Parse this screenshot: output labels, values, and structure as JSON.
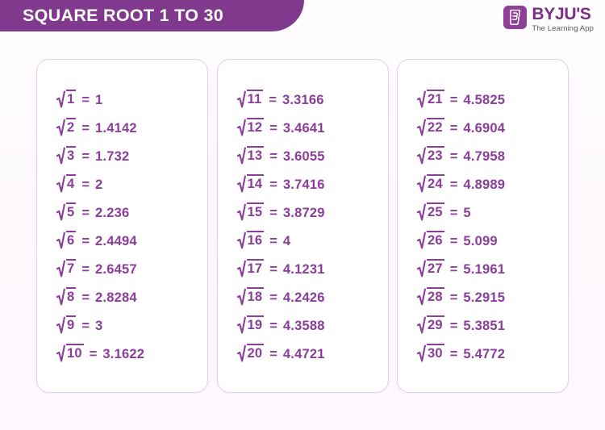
{
  "header": {
    "title": "SQUARE ROOT 1 TO 30",
    "background_color": "#80398c",
    "text_color": "#ffffff"
  },
  "logo": {
    "mark_icon": "byjus-b-logo-icon",
    "name": "BYJU'S",
    "tagline": "The Learning App",
    "mark_color": "#8f3f96",
    "name_color": "#7a2f86"
  },
  "theme": {
    "accent": "#80398c",
    "text_purple": "#8b3d9b",
    "card_border": "#e6cdea",
    "card_background": "#ffffff",
    "page_background": "#fdfbfe"
  },
  "equals_sign": "=",
  "radical_icon": "square-root-icon",
  "columns": [
    {
      "rows": [
        {
          "radicand": "1",
          "value": "1"
        },
        {
          "radicand": "2",
          "value": "1.4142"
        },
        {
          "radicand": "3",
          "value": "1.732"
        },
        {
          "radicand": "4",
          "value": "2"
        },
        {
          "radicand": "5",
          "value": "2.236"
        },
        {
          "radicand": "6",
          "value": "2.4494"
        },
        {
          "radicand": "7",
          "value": "2.6457"
        },
        {
          "radicand": "8",
          "value": "2.8284"
        },
        {
          "radicand": "9",
          "value": "3"
        },
        {
          "radicand": "10",
          "value": "3.1622"
        }
      ]
    },
    {
      "rows": [
        {
          "radicand": "11",
          "value": "3.3166"
        },
        {
          "radicand": "12",
          "value": "3.4641"
        },
        {
          "radicand": "13",
          "value": "3.6055"
        },
        {
          "radicand": "14",
          "value": "3.7416"
        },
        {
          "radicand": "15",
          "value": "3.8729"
        },
        {
          "radicand": "16",
          "value": "4"
        },
        {
          "radicand": "17",
          "value": "4.1231"
        },
        {
          "radicand": "18",
          "value": "4.2426"
        },
        {
          "radicand": "19",
          "value": "4.3588"
        },
        {
          "radicand": "20",
          "value": "4.4721"
        }
      ]
    },
    {
      "rows": [
        {
          "radicand": "21",
          "value": "4.5825"
        },
        {
          "radicand": "22",
          "value": "4.6904"
        },
        {
          "radicand": "23",
          "value": "4.7958"
        },
        {
          "radicand": "24",
          "value": "4.8989"
        },
        {
          "radicand": "25",
          "value": "5"
        },
        {
          "radicand": "26",
          "value": "5.099"
        },
        {
          "radicand": "27",
          "value": "5.1961"
        },
        {
          "radicand": "28",
          "value": "5.2915"
        },
        {
          "radicand": "29",
          "value": "5.3851"
        },
        {
          "radicand": "30",
          "value": "5.4772"
        }
      ]
    }
  ]
}
